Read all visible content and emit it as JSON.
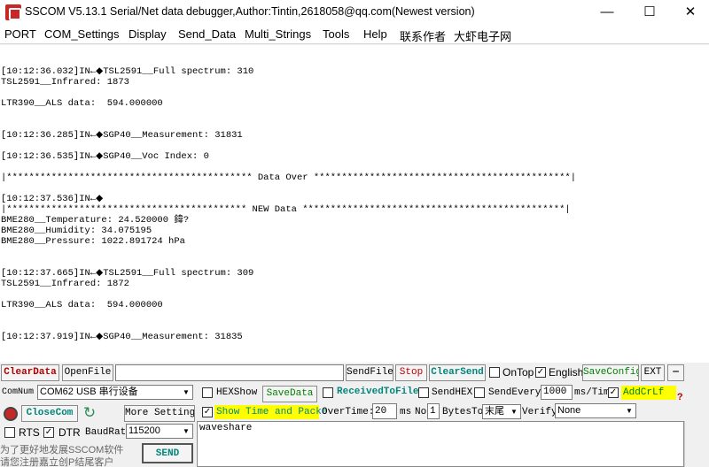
{
  "window": {
    "title": "SSCOM V5.13.1 Serial/Net data debugger,Author:Tintin,2618058@qq.com(Newest version)",
    "min": "—",
    "max": "☐",
    "close": "✕"
  },
  "menu": [
    "PORT",
    "COM_Settings",
    "Display",
    "Send_Data",
    "Multi_Strings",
    "Tools",
    "Help",
    "联系作者",
    "大虾电子网"
  ],
  "receive_lines": [
    "[10:12:36.032]IN←◆TSL2591__Full spectrum: 310",
    "TSL2591__Infrared: 1873",
    "",
    "LTR390__ALS data:  594.000000",
    "",
    "",
    "[10:12:36.285]IN←◆SGP40__Measurement: 31831",
    "",
    "[10:12:36.535]IN←◆SGP40__Voc Index: 0",
    "",
    "|******************************************** Data Over **********************************************|",
    "",
    "[10:12:37.536]IN←◆",
    "|******************************************* NEW Data ***********************************************|",
    "BME280__Temperature: 24.520000 鍏?",
    "BME280__Humidity: 34.075195",
    "BME280__Pressure: 1022.891724 hPa",
    "",
    "",
    "[10:12:37.665]IN←◆TSL2591__Full spectrum: 309",
    "TSL2591__Infrared: 1872",
    "",
    "LTR390__ALS data:  594.000000",
    "",
    "",
    "[10:12:37.919]IN←◆SGP40__Measurement: 31835"
  ],
  "toolbar": {
    "clear_data": "ClearData",
    "open_file": "OpenFile",
    "file_path": "",
    "send_file": "SendFile",
    "stop": "Stop",
    "clear_send": "ClearSend",
    "ontop": "OnTop",
    "ontop_checked": false,
    "english": "English",
    "english_checked": true,
    "save_config": "SaveConfig",
    "ext": "EXT",
    "dash": "—"
  },
  "port": {
    "comnum_label": "ComNum",
    "com_value": "COM62 USB 串行设备",
    "close_com": "CloseCom",
    "more_settings": "More Settings",
    "rts_label": "RTS",
    "rts_checked": false,
    "dtr_label": "DTR",
    "dtr_checked": true,
    "baud_label": "BaudRat",
    "baud_value": "115200"
  },
  "options": {
    "hexshow": "HEXShow",
    "hexshow_checked": false,
    "savedata": "SaveData",
    "received_to_file": "ReceivedToFile",
    "received_to_file_checked": false,
    "sendhex": "SendHEX",
    "sendhex_checked": false,
    "sendevery": "SendEvery:",
    "sendevery_checked": false,
    "sendevery_value": "1000",
    "ms_tim": "ms/Tim",
    "addcrlf": "AddCrLf",
    "addcrlf_checked": true,
    "show_time": "Show Time and Packe",
    "show_time_checked": true,
    "overtime_label": "OverTime:",
    "overtime_value": "20",
    "ms": "ms",
    "no": "No",
    "bytesto_value": "1",
    "bytesto": "BytesTo",
    "tail_value": "末尾",
    "verify": "Verify",
    "verify_value": "None",
    "help": "?"
  },
  "send": {
    "text": "waveshare",
    "send_button": "SEND",
    "promo_line1": "为了更好地发展SSCOM软件",
    "promo_line2": "请您注册嘉立创P结尾客户"
  },
  "colors": {
    "accent_red": "#b00000",
    "accent_teal": "#00867a",
    "highlight_yellow": "#ffff00",
    "green": "#008000"
  }
}
